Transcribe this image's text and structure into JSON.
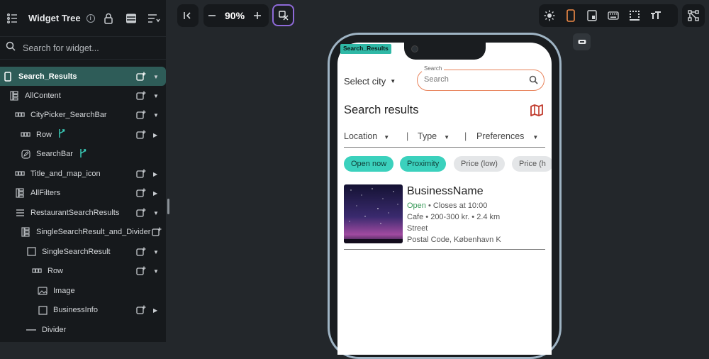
{
  "sidebar": {
    "title": "Widget Tree",
    "search_placeholder": "Search for widget...",
    "items": [
      {
        "label": "Search_Results"
      },
      {
        "label": "AllContent"
      },
      {
        "label": "CityPicker_SearchBar"
      },
      {
        "label": "Row"
      },
      {
        "label": "SearchBar"
      },
      {
        "label": "Title_and_map_icon"
      },
      {
        "label": "AllFilters"
      },
      {
        "label": "RestaurantSearchResults"
      },
      {
        "label": "SingleSearchResult_and_Divider"
      },
      {
        "label": "SingleSearchResult"
      },
      {
        "label": "Row"
      },
      {
        "label": "Image"
      },
      {
        "label": "BusinessInfo"
      },
      {
        "label": "Divider"
      }
    ]
  },
  "toolbar": {
    "zoom": "90%"
  },
  "canvas": {
    "selected_tag": "Search_Results"
  },
  "app": {
    "city_label": "Select city",
    "search_label": "Search",
    "search_placeholder": "Search",
    "title": "Search results",
    "filters": [
      "Location",
      "Type",
      "Preferences"
    ],
    "filter_sep": "|",
    "chips": [
      {
        "label": "Open now"
      },
      {
        "label": "Proximity"
      },
      {
        "label": "Price (low)"
      },
      {
        "label": "Price (h"
      }
    ],
    "result": {
      "name": "BusinessName",
      "status": "Open",
      "bullet": "•",
      "closes": "Closes at 10:00",
      "details": "Cafe • 200-300 kr. • 2.4 km",
      "street": "Street",
      "postal": "Postal Code, København K"
    }
  },
  "colors": {
    "accent": "#3bd1bd",
    "selected_bg": "#2e5c58",
    "search_border": "#e8825a",
    "map_icon": "#c0392b",
    "open_green": "#3a9a5a"
  }
}
